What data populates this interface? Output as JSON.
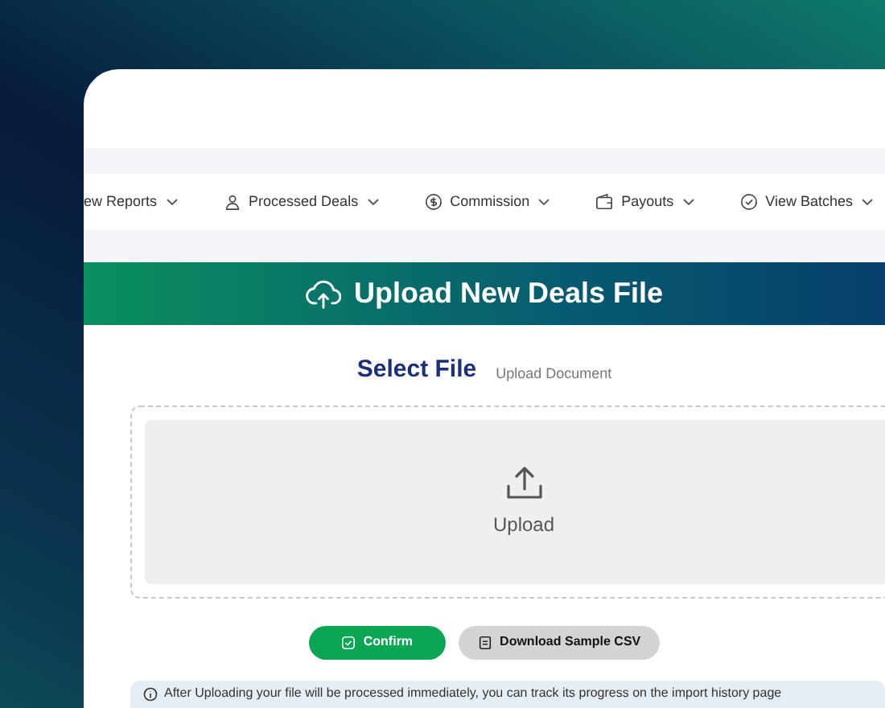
{
  "nav": [
    {
      "label": "ew Reports"
    },
    {
      "label": "Processed Deals"
    },
    {
      "label": "Commission"
    },
    {
      "label": "Payouts"
    },
    {
      "label": "View Batches"
    }
  ],
  "banner": {
    "title": "Upload New Deals File"
  },
  "section": {
    "title": "Select File",
    "subtitle": "Upload Document"
  },
  "dropzone": {
    "label": "Upload"
  },
  "buttons": [
    {
      "label": "Confirm",
      "kind": "primary"
    },
    {
      "label": "Download Sample CSV",
      "kind": "secondary"
    }
  ],
  "info": {
    "text": "After Uploading your file will be processed immediately, you can track its progress on the import history page"
  }
}
